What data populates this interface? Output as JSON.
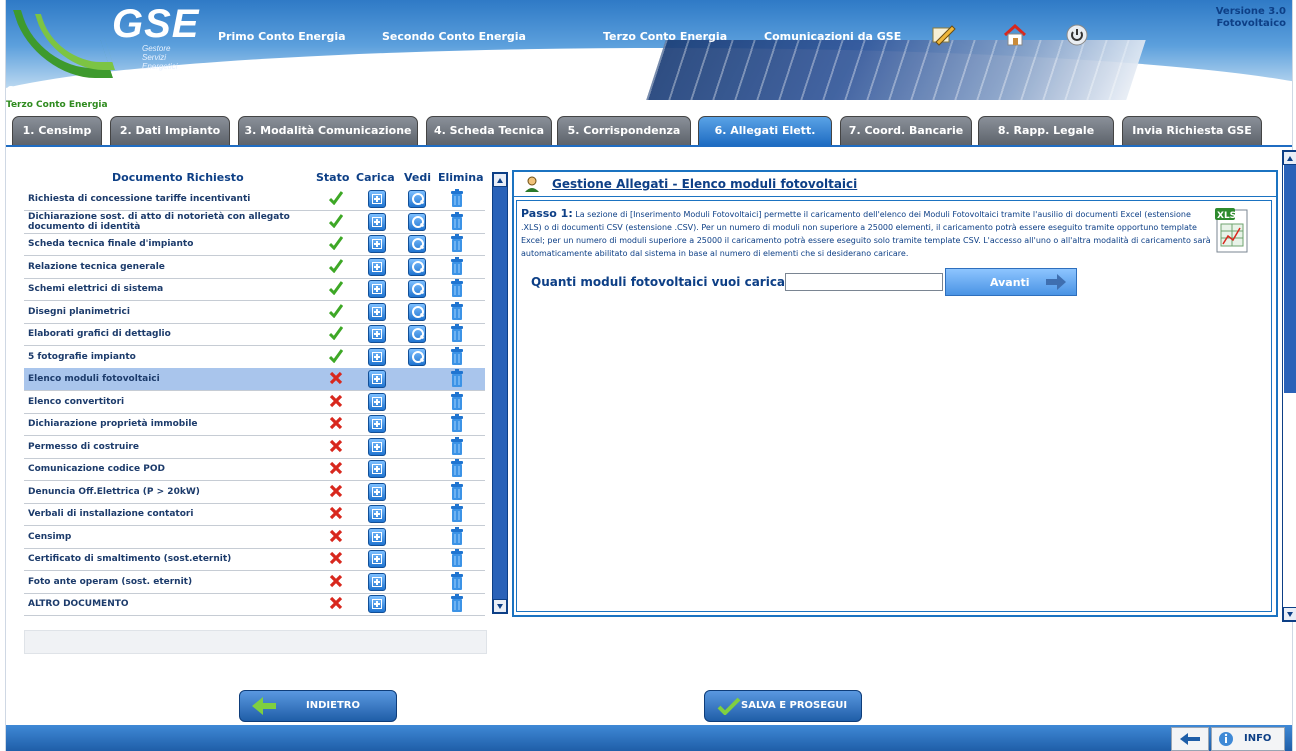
{
  "app": {
    "logo_text": "GSE",
    "logo_sub": [
      "Gestore",
      "Servizi",
      "Energetici"
    ],
    "version_line1": "Versione 3.0",
    "version_line2": "Fotovoltaico",
    "section_title": "6. Allegati",
    "subtitle": "Terzo Conto Energia"
  },
  "nav": {
    "items": [
      "Primo Conto Energia",
      "Secondo Conto Energia",
      "Terzo Conto Energia",
      "Comunicazioni da GSE"
    ],
    "icons": [
      "edit-icon",
      "home-icon",
      "power-icon"
    ]
  },
  "tabs": [
    {
      "label": "1. Censimp",
      "active": false
    },
    {
      "label": "2. Dati Impianto",
      "active": false
    },
    {
      "label": "3. Modalità Comunicazione",
      "active": false
    },
    {
      "label": "4. Scheda Tecnica",
      "active": false
    },
    {
      "label": "5. Corrispondenza",
      "active": false
    },
    {
      "label": "6. Allegati Elett.",
      "active": true
    },
    {
      "label": "7. Coord. Bancarie",
      "active": false
    },
    {
      "label": "8. Rapp. Legale",
      "active": false
    },
    {
      "label": "Invia Richiesta GSE",
      "active": false
    }
  ],
  "documents": {
    "headers": {
      "name": "Documento Richiesto",
      "status": "Stato",
      "upload": "Carica",
      "view": "Vedi",
      "delete": "Elimina"
    },
    "rows": [
      {
        "name": "Richiesta di concessione tariffe incentivanti",
        "status": "ok",
        "view": true
      },
      {
        "name": "Dichiarazione sost. di atto di notorietà con allegato documento di identità",
        "status": "ok",
        "view": true
      },
      {
        "name": "Scheda tecnica finale d'impianto",
        "status": "ok",
        "view": true
      },
      {
        "name": "Relazione tecnica generale",
        "status": "ok",
        "view": true
      },
      {
        "name": "Schemi elettrici di sistema",
        "status": "ok",
        "view": true
      },
      {
        "name": "Disegni planimetrici",
        "status": "ok",
        "view": true
      },
      {
        "name": "Elaborati grafici di dettaglio",
        "status": "ok",
        "view": true
      },
      {
        "name": "5 fotografie impianto",
        "status": "ok",
        "view": true
      },
      {
        "name": "Elenco moduli fotovoltaici",
        "status": "missing",
        "view": false,
        "selected": true
      },
      {
        "name": "Elenco convertitori",
        "status": "missing",
        "view": false
      },
      {
        "name": "Dichiarazione proprietà immobile",
        "status": "missing",
        "view": false
      },
      {
        "name": "Permesso di costruire",
        "status": "missing",
        "view": false
      },
      {
        "name": "Comunicazione codice POD",
        "status": "missing",
        "view": false
      },
      {
        "name": "Denuncia Off.Elettrica (P > 20kW)",
        "status": "missing",
        "view": false
      },
      {
        "name": "Verbali di installazione contatori",
        "status": "missing",
        "view": false
      },
      {
        "name": "Censimp",
        "status": "missing",
        "view": false
      },
      {
        "name": "Certificato di smaltimento (sost.eternit)",
        "status": "missing",
        "view": false
      },
      {
        "name": "Foto ante operam (sost. eternit)",
        "status": "missing",
        "view": false
      },
      {
        "name": "ALTRO DOCUMENTO",
        "status": "missing",
        "view": false
      }
    ]
  },
  "panel": {
    "title_left": "Gestione Allegati",
    "title_sep": "-",
    "title_right": "Elenco moduli fotovoltaici",
    "step_label": "Passo 1:",
    "step_text": "La sezione di [Inserimento Moduli Fotovoltaici] permette il caricamento dell'elenco dei Moduli Fotovoltaici tramite l'ausilio di documenti Excel (estensione .XLS) o di documenti CSV (estensione .CSV). Per un numero di moduli non superiore a 25000 elementi, il caricamento potrà essere eseguito tramite opportuno template Excel; per un numero di moduli superiore a 25000 il caricamento potrà essere eseguito solo tramite template CSV. L'accesso all'uno o all'altra modalità di caricamento sarà automaticamente abilitato dal sistema in base al numero di elementi che si desiderano caricare.",
    "xls_label": "XLS",
    "question": "Quanti moduli fotovoltaici vuoi caricare?",
    "input_value": "",
    "next_label": "Avanti"
  },
  "bottom": {
    "back_label": "INDIETRO",
    "save_label": "SALVA E PROSEGUI",
    "info_label": "INFO"
  },
  "colors": {
    "accent": "#1f6cc2",
    "ok": "#3ea826",
    "error": "#d8281e",
    "selected_row": "#a9c5ec"
  }
}
